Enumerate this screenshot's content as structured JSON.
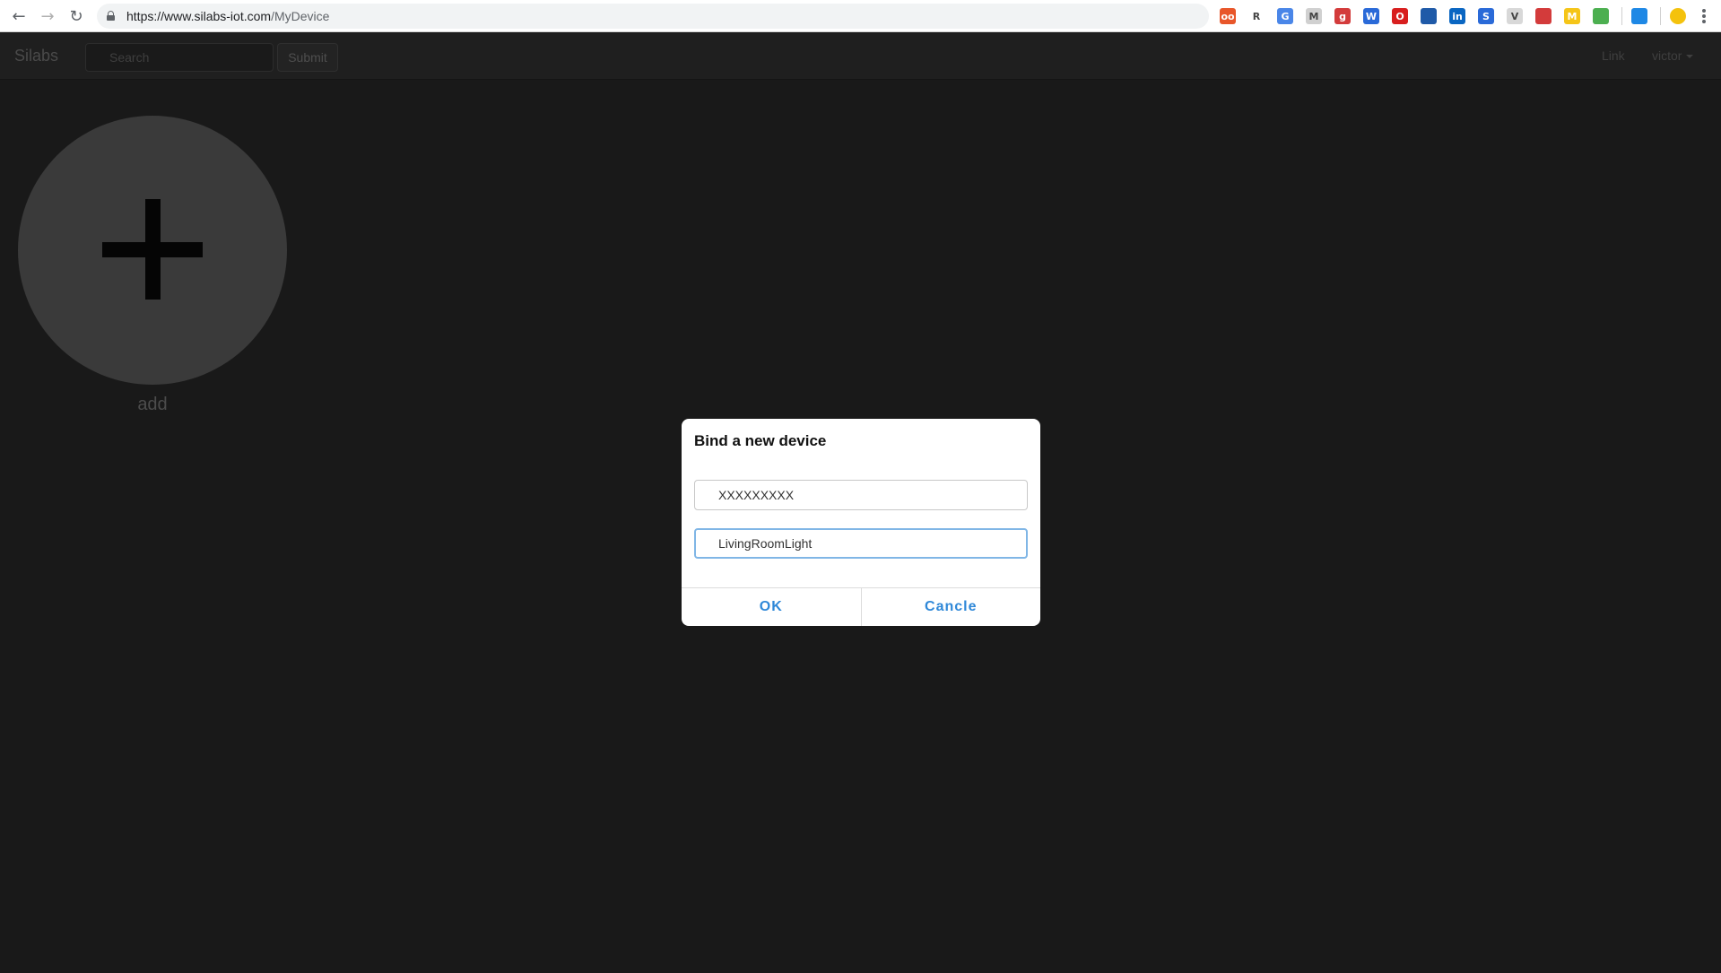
{
  "browser": {
    "url_host": "https://www.silabs-iot.com",
    "url_path": "/MyDevice",
    "extensions": [
      {
        "name": "extension-icon-1",
        "label": "oo",
        "color": "#e8562a"
      },
      {
        "name": "extension-icon-2",
        "label": "R",
        "color": "#ffffff"
      },
      {
        "name": "google-translate-icon",
        "label": "G",
        "color": "#4a86e8"
      },
      {
        "name": "gmail-icon",
        "label": "M",
        "color": "#d0d0d0"
      },
      {
        "name": "extension-icon-5",
        "label": "g",
        "color": "#d33b3b"
      },
      {
        "name": "extension-icon-6",
        "label": "W",
        "color": "#2a6ad8"
      },
      {
        "name": "opera-icon",
        "label": "O",
        "color": "#d81e1e"
      },
      {
        "name": "extension-icon-8",
        "label": "",
        "color": "#1f5aa8"
      },
      {
        "name": "linkedin-icon",
        "label": "in",
        "color": "#0a66c2"
      },
      {
        "name": "extension-icon-10",
        "label": "S",
        "color": "#2a6ad8"
      },
      {
        "name": "extension-icon-11",
        "label": "V",
        "color": "#d8d8d8"
      },
      {
        "name": "extension-icon-12",
        "label": "",
        "color": "#d33b3b"
      },
      {
        "name": "extension-icon-13",
        "label": "M",
        "color": "#f5c518"
      },
      {
        "name": "extension-icon-14",
        "label": "",
        "color": "#4caf50"
      },
      {
        "name": "extension-icon-15",
        "label": "",
        "color": "#1e88e5"
      }
    ]
  },
  "navbar": {
    "brand": "Silabs",
    "search_placeholder": "Search",
    "submit_label": "Submit",
    "link_label": "Link",
    "user_label": "victor"
  },
  "add_tile": {
    "label": "add"
  },
  "modal": {
    "title": "Bind a new device",
    "device_id_value": "XXXXXXXXX",
    "device_name_value": "LivingRoomLight",
    "ok_label": "OK",
    "cancel_label": "Cancle"
  },
  "colors": {
    "page_bg": "#191919",
    "accent": "#2f88d8"
  }
}
